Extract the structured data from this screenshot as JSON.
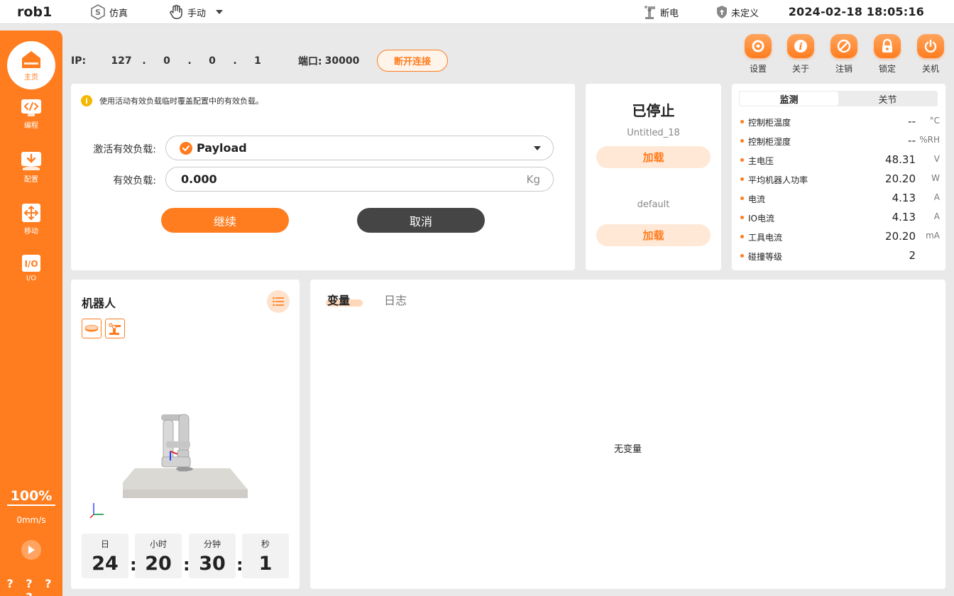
{
  "topbar": {
    "robot_name": "rob1",
    "sim_label": "仿真",
    "mode_label": "手动",
    "power_label": "断电",
    "safety_label": "未定义",
    "datetime": "2024-02-18 18:05:16"
  },
  "sidebar": {
    "items": [
      {
        "label": "主页"
      },
      {
        "label": "编程"
      },
      {
        "label": "配置"
      },
      {
        "label": "移动"
      },
      {
        "label": "I/O"
      }
    ],
    "speed_percent": "100%",
    "speed_value": "0mm/s",
    "unknown_marks": "? ? ? ?"
  },
  "connection": {
    "ip_label": "IP:",
    "ip_parts": [
      "127",
      ".",
      "0",
      ".",
      "0",
      ".",
      "1"
    ],
    "port_label": "端口:",
    "port_value": "30000",
    "disconnect_label": "断开连接"
  },
  "toolbar": {
    "buttons": [
      {
        "label": "设置"
      },
      {
        "label": "关于"
      },
      {
        "label": "注销"
      },
      {
        "label": "锁定"
      },
      {
        "label": "关机"
      }
    ]
  },
  "payload_panel": {
    "notice": "使用活动有效负载临时覆盖配置中的有效负载。",
    "active_label": "激活有效负载:",
    "active_value": "Payload",
    "payload_label": "有效负载:",
    "payload_value": "0.000",
    "payload_unit": "Kg",
    "continue_label": "继续",
    "cancel_label": "取消"
  },
  "program_panel": {
    "status": "已停止",
    "program_name": "Untitled_18",
    "load_label_1": "加载",
    "config_name": "default",
    "load_label_2": "加载"
  },
  "monitor_panel": {
    "tabs": [
      "监测",
      "关节"
    ],
    "rows": [
      {
        "name": "控制柜温度",
        "value": "--",
        "unit": "°C"
      },
      {
        "name": "控制柜湿度",
        "value": "--",
        "unit": "%RH"
      },
      {
        "name": "主电压",
        "value": "48.31",
        "unit": "V"
      },
      {
        "name": "平均机器人功率",
        "value": "20.20",
        "unit": "W"
      },
      {
        "name": "电流",
        "value": "4.13",
        "unit": "A"
      },
      {
        "name": "IO电流",
        "value": "4.13",
        "unit": "A"
      },
      {
        "name": "工具电流",
        "value": "20.20",
        "unit": "mA"
      },
      {
        "name": "碰撞等级",
        "value": "2",
        "unit": ""
      }
    ]
  },
  "robot_panel": {
    "title": "机器人",
    "runtime": [
      {
        "label": "日",
        "value": "24"
      },
      {
        "label": "小时",
        "value": "20"
      },
      {
        "label": "分钟",
        "value": "30"
      },
      {
        "label": "秒",
        "value": "1"
      }
    ],
    "separator": ":"
  },
  "variables_panel": {
    "tabs": [
      "变量",
      "日志"
    ],
    "empty_message": "无变量"
  },
  "colors": {
    "accent": "#ff7d1f",
    "accent_light": "#ffe8d6",
    "dark_button": "#454545",
    "background": "#e9e9ea"
  }
}
